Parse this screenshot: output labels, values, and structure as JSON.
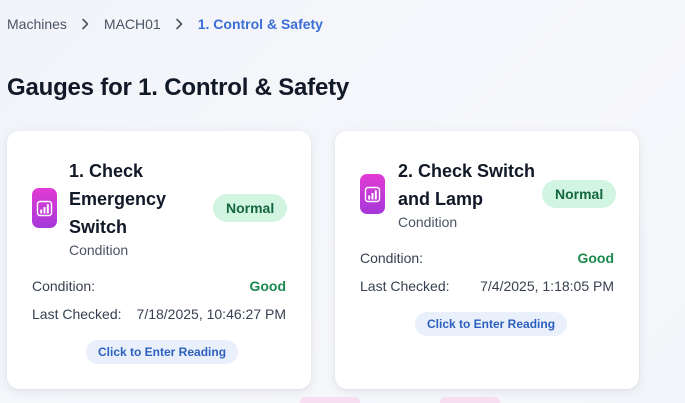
{
  "breadcrumb": {
    "items": [
      "Machines",
      "MACH01"
    ],
    "current": "1. Control & Safety"
  },
  "page": {
    "title": "Gauges for 1. Control & Safety"
  },
  "labels": {
    "condition": "Condition:",
    "last_checked": "Last Checked:",
    "enter_reading": "Click to Enter Reading"
  },
  "gauges": [
    {
      "title_lines": [
        "1. Check",
        "Emergency",
        "Switch"
      ],
      "subtitle": "Condition",
      "status": "Normal",
      "condition": "Good",
      "last_checked": "7/18/2025, 10:46:27 PM"
    },
    {
      "title_lines": [
        "2. Check Switch",
        "and Lamp"
      ],
      "subtitle": "Condition",
      "status": "Normal",
      "condition": "Good",
      "last_checked": "7/4/2025, 1:18:05 PM"
    }
  ],
  "colors": {
    "accent": "#3b6fd6",
    "status_bg": "#d1f5e1",
    "status_text": "#14663e",
    "good": "#1b8a4f",
    "icon_gradient": [
      "#e23bd4",
      "#a538d9"
    ]
  }
}
